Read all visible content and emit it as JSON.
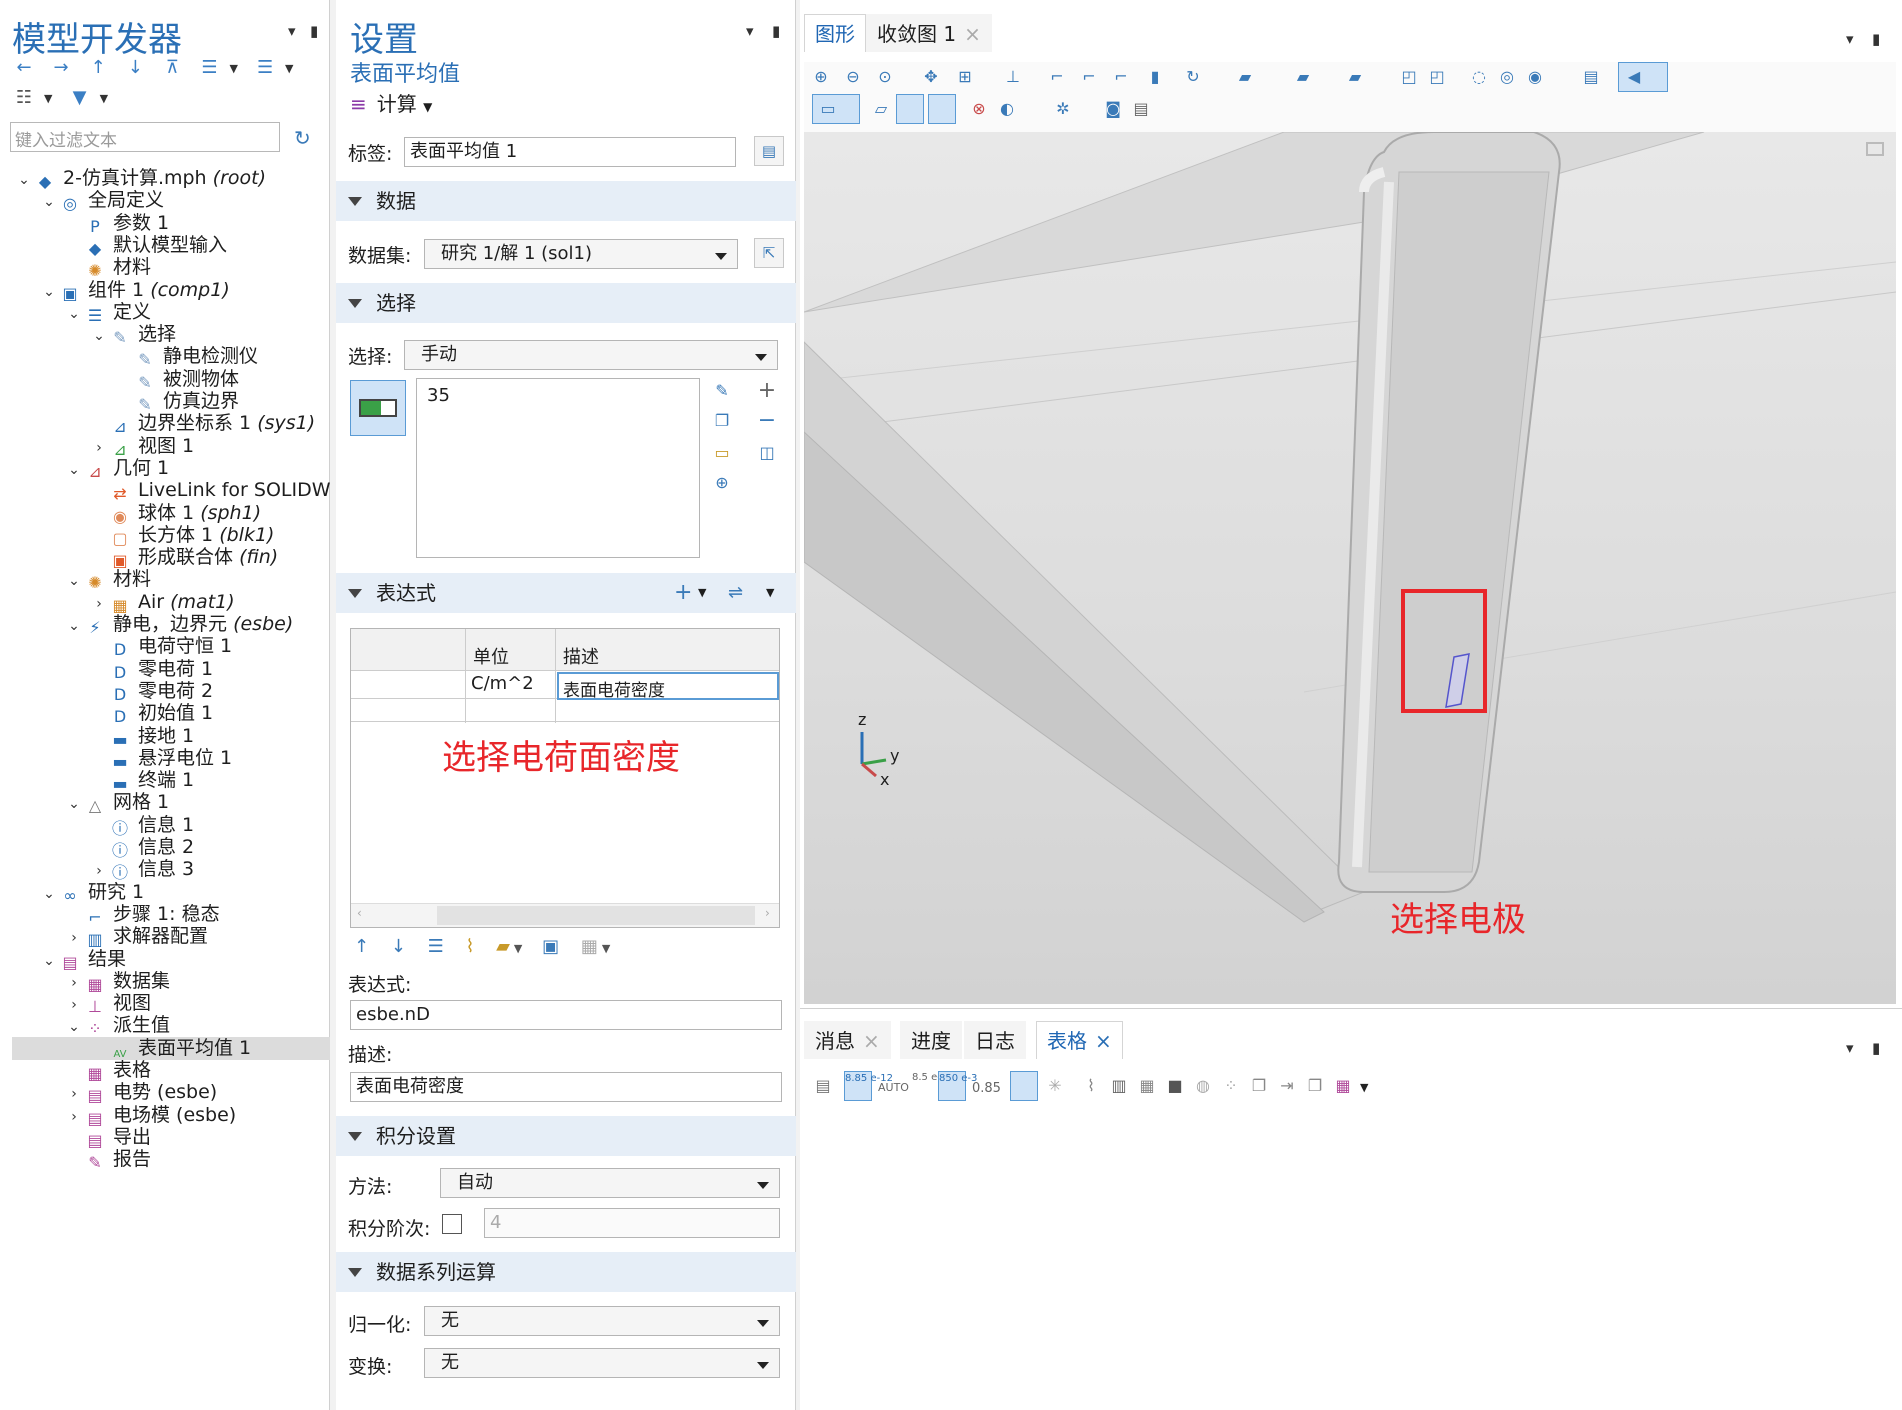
{
  "left": {
    "title": "模型开发器",
    "filter_placeholder": "键入过滤文本",
    "tree": [
      {
        "label": "2-仿真计算.mph",
        "tag": "(root)"
      },
      {
        "label": "全局定义",
        "tag": ""
      },
      {
        "label": "参数 1",
        "tag": ""
      },
      {
        "label": "默认模型输入",
        "tag": ""
      },
      {
        "label": "材料",
        "tag": ""
      },
      {
        "label": "组件 1",
        "tag": "(comp1)"
      },
      {
        "label": "定义",
        "tag": ""
      },
      {
        "label": "选择",
        "tag": ""
      },
      {
        "label": "静电检测仪",
        "tag": ""
      },
      {
        "label": "被测物体",
        "tag": ""
      },
      {
        "label": "仿真边界",
        "tag": ""
      },
      {
        "label": "边界坐标系 1",
        "tag": "(sys1)"
      },
      {
        "label": "视图 1",
        "tag": ""
      },
      {
        "label": "几何 1",
        "tag": ""
      },
      {
        "label": "LiveLink for SOLIDWORKS",
        "tag": ""
      },
      {
        "label": "球体 1",
        "tag": "(sph1)"
      },
      {
        "label": "长方体 1",
        "tag": "(blk1)"
      },
      {
        "label": "形成联合体",
        "tag": "(fin)"
      },
      {
        "label": "材料",
        "tag": ""
      },
      {
        "label": "Air",
        "tag": "(mat1)"
      },
      {
        "label": "静电，边界元",
        "tag": "(esbe)"
      },
      {
        "label": "电荷守恒 1",
        "tag": ""
      },
      {
        "label": "零电荷 1",
        "tag": ""
      },
      {
        "label": "零电荷 2",
        "tag": ""
      },
      {
        "label": "初始值 1",
        "tag": ""
      },
      {
        "label": "接地 1",
        "tag": ""
      },
      {
        "label": "悬浮电位 1",
        "tag": ""
      },
      {
        "label": "终端 1",
        "tag": ""
      },
      {
        "label": "网格 1",
        "tag": ""
      },
      {
        "label": "信息 1",
        "tag": ""
      },
      {
        "label": "信息 2",
        "tag": ""
      },
      {
        "label": "信息 3",
        "tag": ""
      },
      {
        "label": "研究 1",
        "tag": ""
      },
      {
        "label": "步骤 1: 稳态",
        "tag": ""
      },
      {
        "label": "求解器配置",
        "tag": ""
      },
      {
        "label": "结果",
        "tag": ""
      },
      {
        "label": "数据集",
        "tag": ""
      },
      {
        "label": "视图",
        "tag": ""
      },
      {
        "label": "派生值",
        "tag": ""
      },
      {
        "label": "表面平均值 1",
        "tag": ""
      },
      {
        "label": "表格",
        "tag": ""
      },
      {
        "label": "电势 (esbe)",
        "tag": ""
      },
      {
        "label": "电场模 (esbe)",
        "tag": ""
      },
      {
        "label": "导出",
        "tag": ""
      },
      {
        "label": "报告",
        "tag": ""
      }
    ]
  },
  "settings": {
    "title": "设置",
    "subtitle": "表面平均值",
    "compute_label": "计算",
    "tag_label": "标签:",
    "tag_value": "表面平均值 1",
    "sec_data": "数据",
    "dataset_label": "数据集:",
    "dataset_value": "研究 1/解 1 (sol1)",
    "sec_selection": "选择",
    "selection_label": "选择:",
    "selection_value": "手动",
    "selection_list": "35",
    "sec_expression": "表达式",
    "col_unit": "单位",
    "col_desc": "描述",
    "row_unit": "C/m^2",
    "row_desc": "表面电荷密度",
    "expr_label": "表达式:",
    "expr_value": "esbe.nD",
    "desc_label": "描述:",
    "desc_value": "表面电荷密度",
    "sec_integration": "积分设置",
    "method_label": "方法:",
    "method_value": "自动",
    "order_label": "积分阶次:",
    "order_value": "4",
    "sec_series": "数据系列运算",
    "norm_label": "归一化:",
    "norm_value": "无",
    "transform_label": "变换:",
    "transform_value": "无"
  },
  "graphics": {
    "tab1": "图形",
    "tab2": "收敛图 1",
    "axis_z": "z",
    "axis_y": "y",
    "axis_x": "x"
  },
  "bottom": {
    "tabs": [
      "消息",
      "进度",
      "日志",
      "表格"
    ],
    "tb_a": "8.85 e-12",
    "tb_b": "AUTO",
    "tb_c": "8.5 e-1",
    "tb_d": "850 e-3",
    "tb_e": "0.85"
  },
  "annotations": {
    "charge": "选择电荷面密度",
    "electrode": "选择电极"
  },
  "colors": {
    "accent": "#2a6fb5",
    "annotation": "#e8262a"
  }
}
